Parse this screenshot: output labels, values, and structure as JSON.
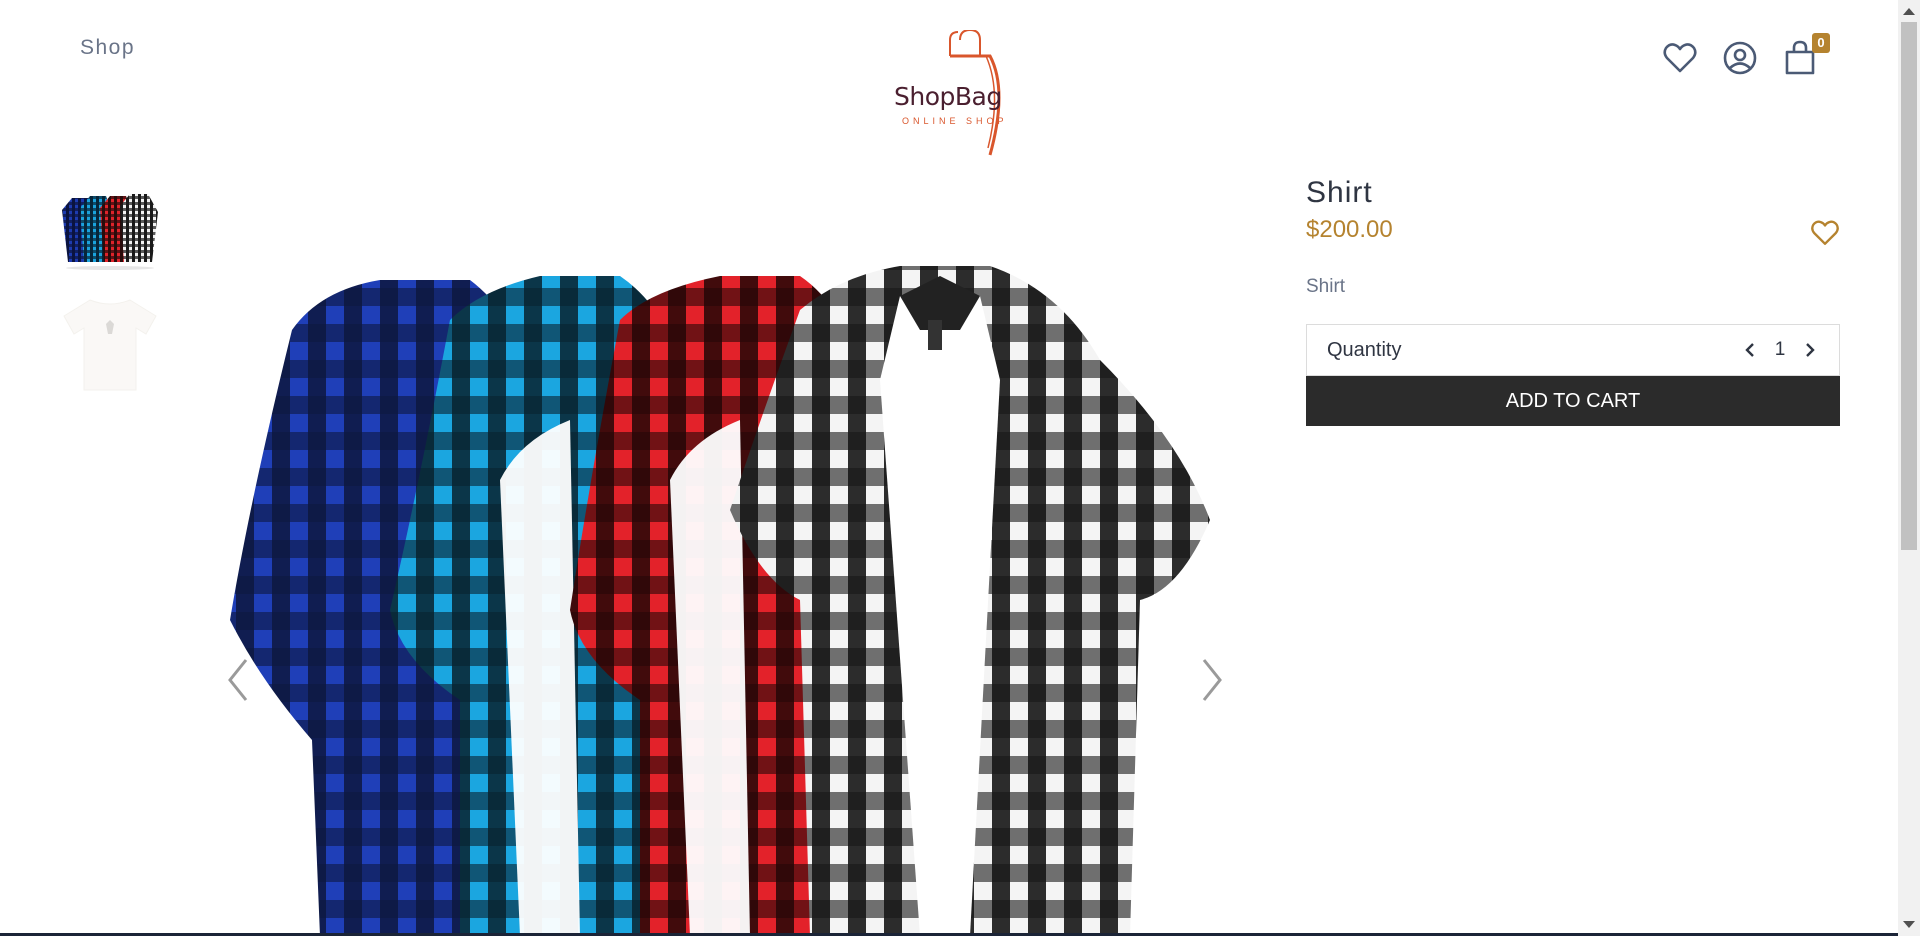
{
  "nav": {
    "shop_label": "Shop"
  },
  "logo": {
    "name": "ShopBag",
    "tagline": "ONLINE SHOP"
  },
  "header": {
    "cart_count": "0"
  },
  "product": {
    "title": "Shirt",
    "price": "$200.00",
    "description": "Shirt",
    "quantity_label": "Quantity",
    "quantity": "1",
    "add_to_cart_label": "ADD TO CART"
  },
  "gallery": {
    "thumbnail_count": 2,
    "main_image": "four plaid short-sleeve shirts (blue, cyan, red, black-white)"
  },
  "colors": {
    "accent": "#b5832f",
    "text": "#2f3542",
    "muted": "#6a7488",
    "button": "#2b2b2b",
    "logo_orange": "#d9562c",
    "logo_maroon": "#4a1f2f"
  }
}
